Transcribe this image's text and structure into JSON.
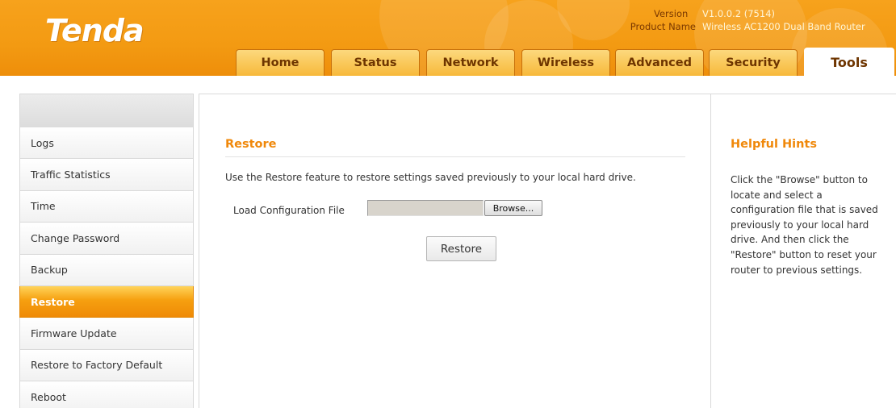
{
  "header": {
    "logo": "Tenda",
    "version_label": "Version",
    "version_value": "V1.0.0.2 (7514)",
    "product_label": "Product Name",
    "product_value": "Wireless AC1200 Dual Band Router"
  },
  "tabs": [
    {
      "label": "Home"
    },
    {
      "label": "Status"
    },
    {
      "label": "Network"
    },
    {
      "label": "Wireless"
    },
    {
      "label": "Advanced"
    },
    {
      "label": "Security"
    },
    {
      "label": "Tools"
    }
  ],
  "active_tab": "Tools",
  "sidebar": {
    "items": [
      {
        "label": "Logs"
      },
      {
        "label": "Traffic Statistics"
      },
      {
        "label": "Time"
      },
      {
        "label": "Change Password"
      },
      {
        "label": "Backup"
      },
      {
        "label": "Restore"
      },
      {
        "label": "Firmware Update"
      },
      {
        "label": "Restore to Factory Default"
      },
      {
        "label": "Reboot"
      }
    ],
    "active": "Restore"
  },
  "main": {
    "title": "Restore",
    "description": "Use the Restore feature to restore settings saved previously to your local hard drive.",
    "load_label": "Load Configuration File",
    "file_value": "",
    "browse_label": "Browse...",
    "restore_label": "Restore"
  },
  "hints": {
    "title": "Helpful Hints",
    "text": "Click the \"Browse\" button to locate and select a configuration file that is saved previously to your local hard drive. And then click the \"Restore\" button to reset your router to previous settings."
  },
  "colors": {
    "brand_orange": "#f39a12",
    "heading_orange": "#f0880a",
    "tab_text": "#6e3500"
  }
}
